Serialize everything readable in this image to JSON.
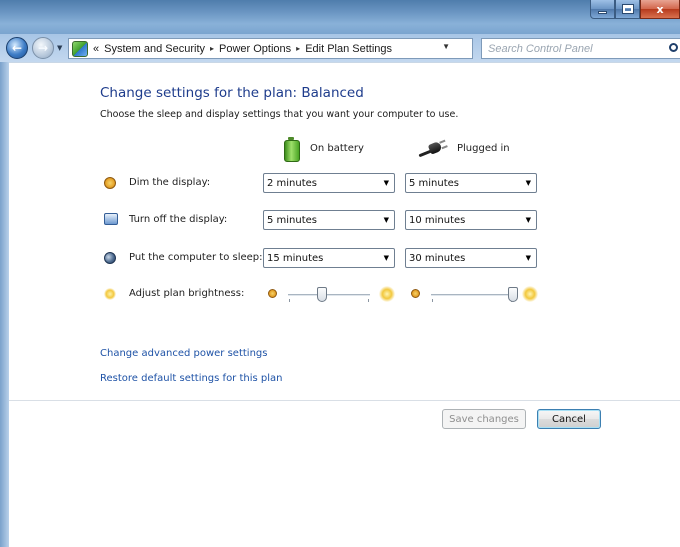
{
  "window": {
    "caption_close_glyph": "x"
  },
  "address_bar": {
    "overflow": "«",
    "breadcrumbs": [
      "System and Security",
      "Power Options",
      "Edit Plan Settings"
    ],
    "separator": "▸"
  },
  "search": {
    "placeholder": "Search Control Panel"
  },
  "page": {
    "heading": "Change settings for the plan: Balanced",
    "subheading": "Choose the sleep and display settings that you want your computer to use.",
    "columns": {
      "battery": "On battery",
      "plugged": "Plugged in"
    },
    "settings": [
      {
        "label": "Dim the display:",
        "on_battery": "2 minutes",
        "plugged_in": "5 minutes"
      },
      {
        "label": "Turn off the display:",
        "on_battery": "5 minutes",
        "plugged_in": "10 minutes"
      },
      {
        "label": "Put the computer to sleep:",
        "on_battery": "15 minutes",
        "plugged_in": "30 minutes"
      }
    ],
    "brightness": {
      "label": "Adjust plan brightness:",
      "on_battery_level": 0.42,
      "plugged_in_level": 1.0
    },
    "links": {
      "advanced": "Change advanced power settings",
      "restore": "Restore default settings for this plan"
    },
    "buttons": {
      "save": "Save changes",
      "cancel": "Cancel"
    }
  }
}
